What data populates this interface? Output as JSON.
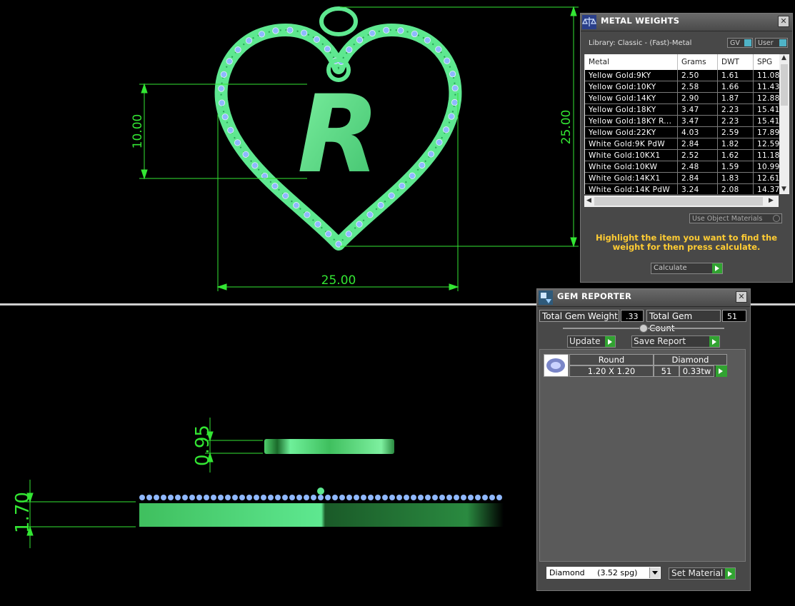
{
  "top_view": {
    "dim_width": "25.00",
    "dim_height": "25.00",
    "dim_letter": "10.00",
    "letter": "R"
  },
  "side_view": {
    "dim_ring": "0.95",
    "dim_pendant": "1.70"
  },
  "metal_weights": {
    "title": "METAL WEIGHTS",
    "library_label": "Library: Classic - (Fast)-Metal",
    "toggle_gv": "GV",
    "toggle_user": "User",
    "columns": [
      "Metal",
      "Grams",
      "DWT",
      "SPG"
    ],
    "rows": [
      {
        "metal": "Yellow Gold:9KY",
        "grams": "2.50",
        "dwt": "1.61",
        "spg": "11.08"
      },
      {
        "metal": "Yellow Gold:10KY",
        "grams": "2.58",
        "dwt": "1.66",
        "spg": "11.43"
      },
      {
        "metal": "Yellow Gold:14KY",
        "grams": "2.90",
        "dwt": "1.87",
        "spg": "12.88"
      },
      {
        "metal": "Yellow Gold:18KY",
        "grams": "3.47",
        "dwt": "2.23",
        "spg": "15.41"
      },
      {
        "metal": "Yellow Gold:18KY R...",
        "grams": "3.47",
        "dwt": "2.23",
        "spg": "15.41"
      },
      {
        "metal": "Yellow Gold:22KY",
        "grams": "4.03",
        "dwt": "2.59",
        "spg": "17.89"
      },
      {
        "metal": "White Gold:9K PdW",
        "grams": "2.84",
        "dwt": "1.82",
        "spg": "12.59"
      },
      {
        "metal": "White Gold:10KX1",
        "grams": "2.52",
        "dwt": "1.62",
        "spg": "11.18"
      },
      {
        "metal": "White Gold:10KW",
        "grams": "2.48",
        "dwt": "1.59",
        "spg": "10.99"
      },
      {
        "metal": "White Gold:14KX1",
        "grams": "2.84",
        "dwt": "1.83",
        "spg": "12.61"
      },
      {
        "metal": "White Gold:14K PdW",
        "grams": "3.24",
        "dwt": "2.08",
        "spg": "14.37"
      }
    ],
    "use_object_materials": "Use Object Materials",
    "highlight_text": "Highlight the item you want to find the weight for then press calculate.",
    "calculate_label": "Calculate"
  },
  "gem_reporter": {
    "title": "GEM REPORTER",
    "total_weight_label": "Total Gem Weight",
    "total_weight_value": ".33",
    "total_count_label": "Total Gem Count",
    "total_count_value": "51",
    "update_label": "Update",
    "save_report_label": "Save Report",
    "gem": {
      "shape": "Round",
      "material": "Diamond",
      "size": "1.20 X 1.20",
      "count": "51",
      "weight": "0.33tw"
    },
    "material_select": "Diamond     (3.52 spg)",
    "set_material_label": "Set Material"
  },
  "colors": {
    "cad_green": "#33e633",
    "model_green": "#5ee890",
    "gem_blue": "#8fb8ff",
    "highlight_yellow": "#ffcc33",
    "go_green": "#31a331"
  }
}
